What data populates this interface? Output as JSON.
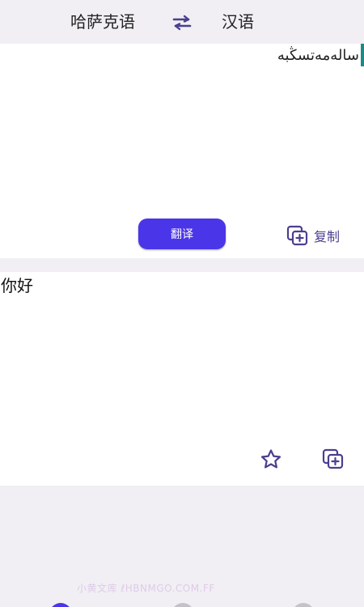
{
  "header": {
    "source_lang": "哈萨克语",
    "target_lang": "汉语",
    "swap_icon": "swap-arrows-icon"
  },
  "input": {
    "text": "ساله‌مه‌تسڭبه"
  },
  "actions": {
    "translate_label": "翻译",
    "copy_label": "复制"
  },
  "output": {
    "text": "你好"
  },
  "output_actions": {
    "favorite_icon": "star-icon",
    "copy_icon": "copy-icon"
  },
  "watermark": {
    "text": "小黄文库 ℓHBNMGO.COM.FF"
  },
  "colors": {
    "accent": "#4b35e8",
    "icon": "#4a3f8f",
    "background": "#f1eff4",
    "panel": "#ffffff"
  },
  "bottom_nav": {
    "active_index": 0,
    "items": [
      "nav-tab-translate",
      "nav-tab-2",
      "nav-tab-3"
    ]
  }
}
